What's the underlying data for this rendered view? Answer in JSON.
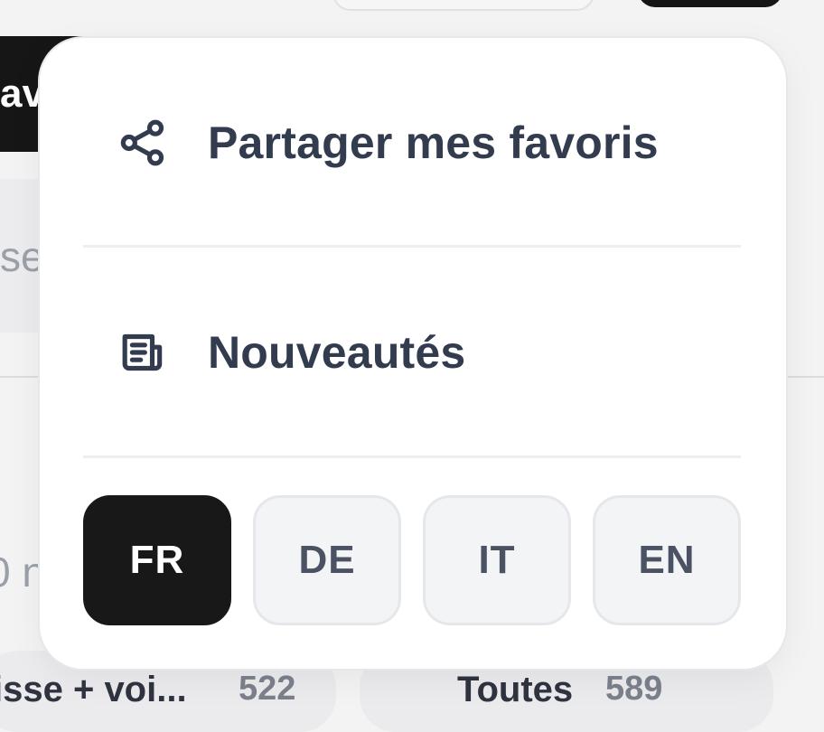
{
  "background": {
    "dark_tab_text": "av",
    "search_fragment": "se",
    "side_fragment": "0 n",
    "chips": [
      {
        "label": "isse + voi...",
        "count": "522"
      },
      {
        "label": "Toutes",
        "count": "589"
      }
    ]
  },
  "menu": {
    "share_label": "Partager mes favoris",
    "share_icon": "share-icon",
    "news_label": "Nouveautés",
    "news_icon": "newspaper-icon"
  },
  "languages": {
    "active": "FR",
    "options": [
      "FR",
      "DE",
      "IT",
      "EN"
    ]
  },
  "colors": {
    "text": "#333c4e",
    "active_lang_bg": "#181818",
    "lang_bg": "#f3f4f6"
  }
}
